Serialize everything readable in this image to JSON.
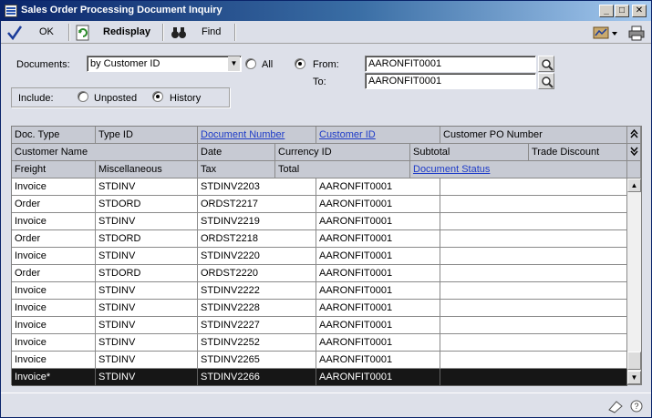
{
  "window": {
    "title": "Sales Order Processing Document Inquiry"
  },
  "toolbar": {
    "ok_label": "OK",
    "redisplay_label": "Redisplay",
    "find_label": "Find"
  },
  "filters": {
    "documents_label": "Documents:",
    "documents_value": "by Customer ID",
    "all_label": "All",
    "from_label": "From:",
    "from_value": "AARONFIT0001",
    "to_label": "To:",
    "to_value": "AARONFIT0001",
    "include_label": "Include:",
    "unposted_label": "Unposted",
    "history_label": "History",
    "selected_range": "From",
    "selected_include": "History"
  },
  "grid": {
    "header_row1": [
      "Doc. Type",
      "Type ID",
      "Document Number",
      "Customer ID",
      "Customer PO Number"
    ],
    "header_row2": [
      "Customer Name",
      "Date",
      "Currency ID",
      "Subtotal",
      "Trade Discount"
    ],
    "header_row3": [
      "Freight",
      "Miscellaneous",
      "Tax",
      "Total",
      "Document Status"
    ],
    "rows": [
      [
        "Invoice",
        "STDINV",
        "STDINV2203",
        "AARONFIT0001",
        ""
      ],
      [
        "Order",
        "STDORD",
        "ORDST2217",
        "AARONFIT0001",
        ""
      ],
      [
        "Invoice",
        "STDINV",
        "STDINV2219",
        "AARONFIT0001",
        ""
      ],
      [
        "Order",
        "STDORD",
        "ORDST2218",
        "AARONFIT0001",
        ""
      ],
      [
        "Invoice",
        "STDINV",
        "STDINV2220",
        "AARONFIT0001",
        ""
      ],
      [
        "Order",
        "STDORD",
        "ORDST2220",
        "AARONFIT0001",
        ""
      ],
      [
        "Invoice",
        "STDINV",
        "STDINV2222",
        "AARONFIT0001",
        ""
      ],
      [
        "Invoice",
        "STDINV",
        "STDINV2228",
        "AARONFIT0001",
        ""
      ],
      [
        "Invoice",
        "STDINV",
        "STDINV2227",
        "AARONFIT0001",
        ""
      ],
      [
        "Invoice",
        "STDINV",
        "STDINV2252",
        "AARONFIT0001",
        ""
      ],
      [
        "Invoice",
        "STDINV",
        "STDINV2265",
        "AARONFIT0001",
        ""
      ],
      [
        "Invoice*",
        "STDINV",
        "STDINV2266",
        "AARONFIT0001",
        ""
      ]
    ],
    "selected_row": 11
  },
  "colors": {
    "title_start": "#0a246a",
    "title_end": "#a6caf0",
    "link": "#1d3bc8",
    "selection": "#161616"
  },
  "icons": [
    "check-icon",
    "redisplay-icon",
    "binoculars-icon",
    "magnifier-icon",
    "chevron-up-icon",
    "chevron-down-icon",
    "note-icon",
    "printer-icon",
    "window-icon"
  ]
}
